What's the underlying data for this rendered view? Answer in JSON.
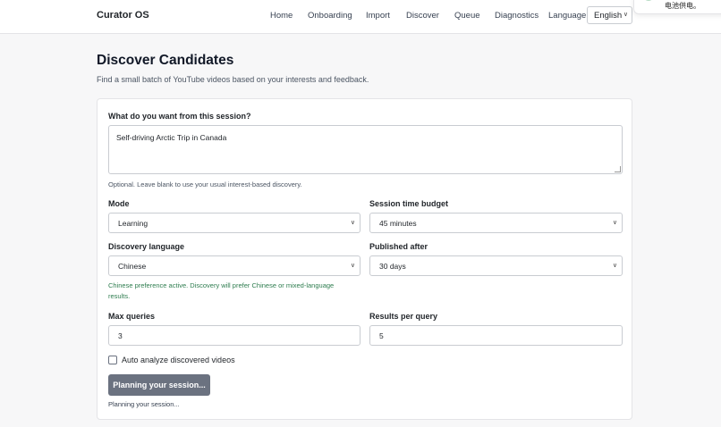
{
  "header": {
    "brand": "Curator OS",
    "nav": [
      "Home",
      "Onboarding",
      "Import",
      "Discover",
      "Queue",
      "Diagnostics"
    ],
    "language_label": "Language",
    "language_value": "English"
  },
  "toast": {
    "text": "电池供电。"
  },
  "page": {
    "title": "Discover Candidates",
    "subtitle": "Find a small batch of YouTube videos based on your interests and feedback."
  },
  "form": {
    "prompt_label": "What do you want from this session?",
    "prompt_value": "Self-driving Arctic Trip in Canada",
    "prompt_hint": "Optional. Leave blank to use your usual interest-based discovery.",
    "mode_label": "Mode",
    "mode_value": "Learning",
    "budget_label": "Session time budget",
    "budget_value": "45 minutes",
    "discovery_language_label": "Discovery language",
    "discovery_language_value": "Chinese",
    "published_label": "Published after",
    "published_value": "30 days",
    "language_note": "Chinese preference active. Discovery will prefer Chinese or mixed-language results.",
    "max_queries_label": "Max queries",
    "max_queries_value": "3",
    "results_label": "Results per query",
    "results_value": "5",
    "auto_analyze_label": "Auto analyze discovered videos",
    "auto_analyze_checked": false,
    "submit_label": "Planning your session...",
    "status_text": "Planning your session..."
  },
  "colors": {
    "background": "#f7f7f8",
    "card": "#ffffff",
    "button_disabled": "#6b7280",
    "note_green": "#2e7d4f"
  }
}
